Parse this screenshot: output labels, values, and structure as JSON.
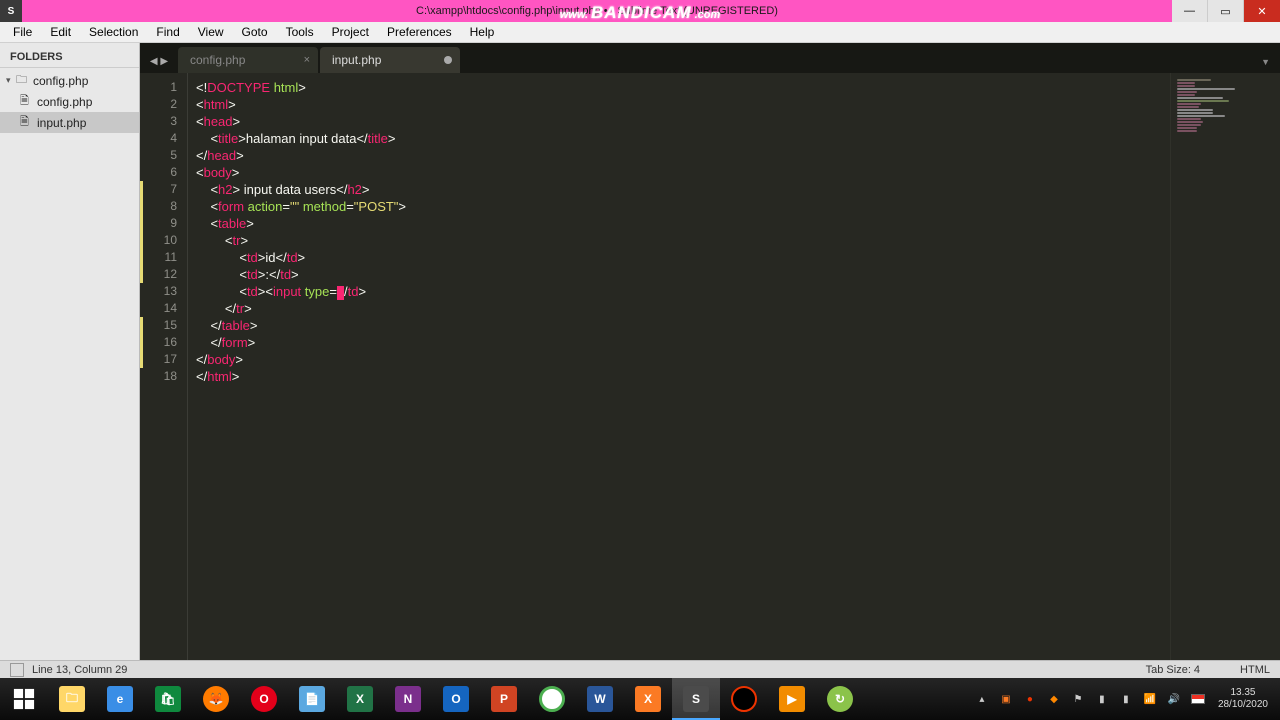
{
  "window": {
    "title": "C:\\xampp\\htdocs\\config.php\\input.php • - Sublime Text (UNREGISTERED)"
  },
  "watermark": {
    "www": "www.",
    "brand": "BANDICAM",
    "com": ".com"
  },
  "menu": [
    "File",
    "Edit",
    "Selection",
    "Find",
    "View",
    "Goto",
    "Tools",
    "Project",
    "Preferences",
    "Help"
  ],
  "sidebar": {
    "header": "FOLDERS",
    "root": "config.php",
    "files": [
      "config.php",
      "input.php"
    ]
  },
  "tabs": [
    {
      "name": "config.php",
      "active": false,
      "dirty": false
    },
    {
      "name": "input.php",
      "active": true,
      "dirty": true
    }
  ],
  "status": {
    "cursor": "Line 13, Column 29",
    "tabsize": "Tab Size: 4",
    "syntax": "HTML"
  },
  "clock": {
    "time": "13.35",
    "date": "28/10/2020"
  },
  "code": {
    "lines": 18,
    "content_summary": "PHP/HTML file input.php containing DOCTYPE, html, head, title 'halaman input data', body with h2 'input data users', form method POST, table with tr/td for 'id' and an incomplete input tag at line 13"
  }
}
